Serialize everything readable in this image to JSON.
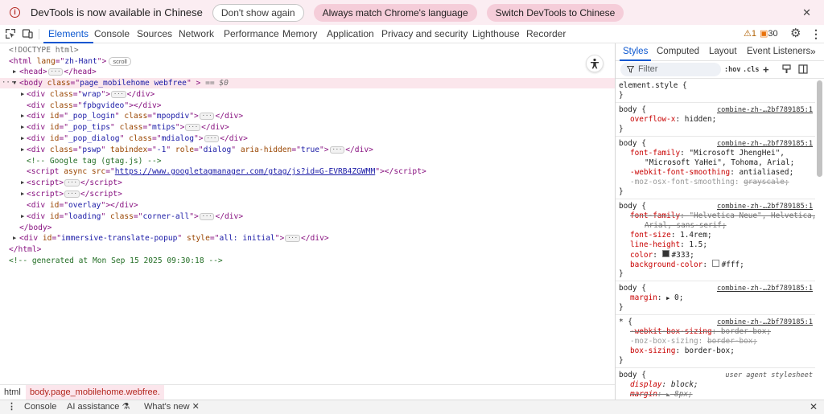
{
  "infobar": {
    "message": "DevTools is now available in Chinese",
    "dont_show": "Don't show again",
    "always_match": "Always match Chrome's language",
    "switch_lang": "Switch DevTools to Chinese",
    "close": "✕"
  },
  "tabs": [
    "Elements",
    "Console",
    "Sources",
    "Network",
    "Performance",
    "Memory",
    "Application",
    "Privacy and security",
    "Lighthouse",
    "Recorder"
  ],
  "badges": {
    "warnings": "1",
    "issues": "30"
  },
  "dom": {
    "doctype": "<!DOCTYPE html>",
    "html_lang": "zh-Hant",
    "scroll_chip": "scroll",
    "body_class": "page_mobilehome webfree",
    "dollar0": "== $0",
    "div_wrap": "wrap",
    "div_fpbgvideo": "fpbgvideo",
    "pop_login_id": "_pop_login",
    "pop_login_class": "mpopdiv",
    "pop_tips_id": "_pop_tips",
    "pop_tips_class": "mtips",
    "pop_dialog_id": "_pop_dialog",
    "pop_dialog_class": "mdialog",
    "pswp_class": "pswp",
    "pswp_tabindex": "-1",
    "pswp_role": "dialog",
    "pswp_hidden": "true",
    "comment_gtag": "<!-- Google tag (gtag.js) -->",
    "gtag_src": "https://www.googletagmanager.com/gtag/js?id=G-EVRB4ZGWMM",
    "overlay_id": "overlay",
    "loading_id": "loading",
    "loading_class": "corner-all",
    "immersive_id": "immersive-translate-popup",
    "immersive_style": "all: initial",
    "generated_comment": "<!-- generated at Mon Sep 15 2025 09:30:18 -->"
  },
  "breadcrumbs": [
    "html",
    "body.page_mobilehome.webfree."
  ],
  "drawer": {
    "console": "Console",
    "ai": "AI assistance",
    "whats_new": "What's new",
    "close": "✕"
  },
  "styles": {
    "subtabs": [
      "Styles",
      "Computed",
      "Layout",
      "Event Listeners"
    ],
    "filter_placeholder": "Filter",
    "hov": ":hov",
    "cls": ".cls",
    "source_file": "combine-zh-…2bf789185:1",
    "ua_source": "user agent stylesheet",
    "element_style": "element.style {",
    "font_family_1": "\"Microsoft JhengHei\",",
    "font_family_2": "\"Microsoft YaHei\", Tohoma, Arial;",
    "smoothing": "antialiased;",
    "osx_smoothing": "grayscale;",
    "font_family_struck_1": "\"Helvetica Neue\", Helvetica,",
    "font_family_struck_2": "Arial, sans-serif;",
    "font_size": "1.4rem;",
    "line_height": "1.5;",
    "color": "#333;",
    "bg_color": "#fff;",
    "margin_zero": "0;",
    "border_box": "border-box;",
    "display_block": "block;",
    "margin_8": "8px;",
    "accent": "#0b57d0",
    "selection": "#fbe6ec"
  }
}
